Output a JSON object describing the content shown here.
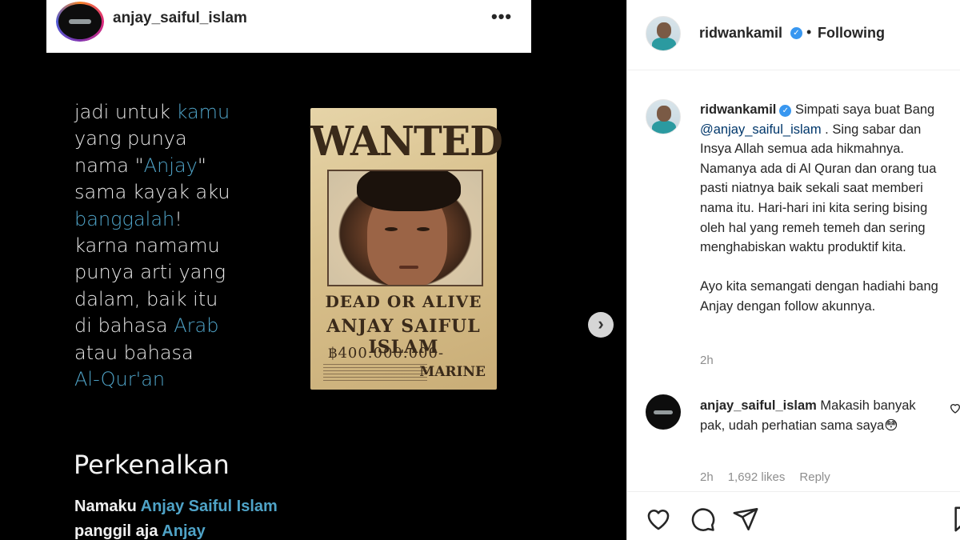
{
  "embed": {
    "username": "anjay_saiful_islam",
    "more": "•••"
  },
  "poem": {
    "l1a": "jadi untuk ",
    "l1b": "kamu",
    "l2": "yang punya",
    "l3a": "nama \"",
    "l3b": "Anjay",
    "l3c": "\"",
    "l4": "sama kayak aku",
    "l5a": "banggalah",
    "l5b": "!",
    "l6": "karna namamu",
    "l7": "punya arti yang",
    "l8": "dalam, baik itu",
    "l9a": "di bahasa ",
    "l9b": "Arab",
    "l10": "atau bahasa",
    "l11": "Al-Qur'an"
  },
  "poster": {
    "title": "WANTED",
    "dead_or_alive": "DEAD OR ALIVE",
    "name": "ANJAY SAIFUL ISLAM",
    "bounty": "฿400.000.000-",
    "marine": "MARINE"
  },
  "intro": {
    "heading": "Perkenalkan",
    "line1_a": "Namaku ",
    "line1_b": "Anjay Saiful Islam",
    "line2_a": "panggil aja ",
    "line2_b": "Anjay"
  },
  "header": {
    "username": "ridwankamil",
    "dot": "•",
    "follow_status": "Following"
  },
  "caption": {
    "username": "ridwankamil",
    "text_a": " Simpati saya buat Bang ",
    "mention": "@anjay_saiful_islam",
    "text_b": " . Sing sabar dan Insya Allah semua ada hikmahnya. Namanya ada di Al Quran dan orang tua pasti niatnya baik sekali saat memberi nama itu. Hari-hari ini kita sering bising oleh hal yang remeh temeh dan sering menghabiskan waktu produktif kita.",
    "text_c": "Ayo kita semangati dengan hadiahi bang Anjay dengan follow akunnya.",
    "time": "2h"
  },
  "reply": {
    "username": "anjay_saiful_islam",
    "text": " Makasih banyak pak, udah perhatian sama saya😳",
    "time": "2h",
    "likes": "1,692 likes",
    "reply_label": "Reply"
  }
}
